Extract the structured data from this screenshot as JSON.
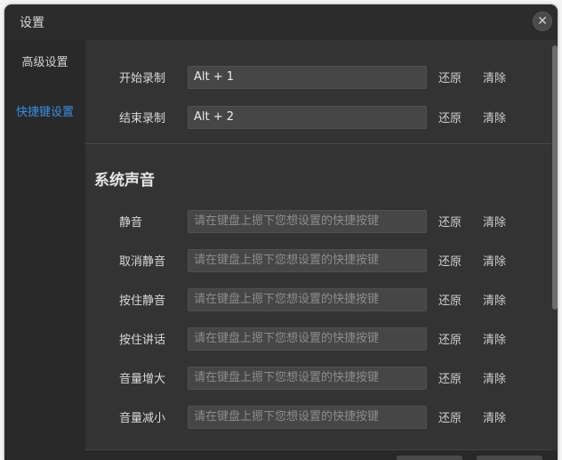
{
  "window": {
    "title": "设置"
  },
  "sidebar": {
    "items": [
      {
        "label": "高级设置"
      },
      {
        "label": "快捷键设置"
      }
    ]
  },
  "recording": {
    "rows": [
      {
        "label": "开始录制",
        "value": "Alt + 1",
        "restore": "还原",
        "clear": "清除"
      },
      {
        "label": "结束录制",
        "value": "Alt + 2",
        "restore": "还原",
        "clear": "清除"
      }
    ]
  },
  "system_sound": {
    "title": "系统声音",
    "rows": [
      {
        "label": "静音",
        "placeholder": "请在键盘上摁下您想设置的快捷按键",
        "restore": "还原",
        "clear": "清除"
      },
      {
        "label": "取消静音",
        "placeholder": "请在键盘上摁下您想设置的快捷按键",
        "restore": "还原",
        "clear": "清除"
      },
      {
        "label": "按住静音",
        "placeholder": "请在键盘上摁下您想设置的快捷按键",
        "restore": "还原",
        "clear": "清除"
      },
      {
        "label": "按住讲话",
        "placeholder": "请在键盘上摁下您想设置的快捷按键",
        "restore": "还原",
        "clear": "清除"
      },
      {
        "label": "音量增大",
        "placeholder": "请在键盘上摁下您想设置的快捷按键",
        "restore": "还原",
        "clear": "清除"
      },
      {
        "label": "音量减小",
        "placeholder": "请在键盘上摁下您想设置的快捷按键",
        "restore": "还原",
        "clear": "清除"
      }
    ]
  },
  "icons": {
    "close": "close-icon"
  },
  "colors": {
    "accent": "#3a8fe0",
    "window_bg": "#333334",
    "sidebar_bg": "#29292a",
    "input_bg": "#464647"
  }
}
